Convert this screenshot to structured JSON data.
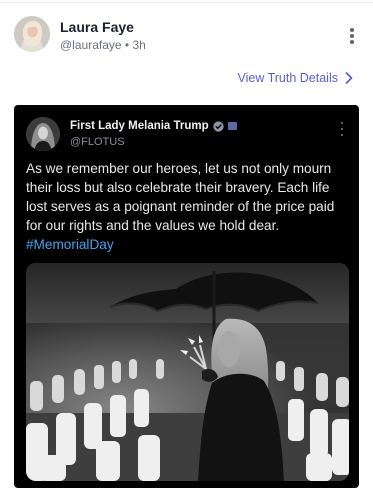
{
  "post": {
    "author_name": "Laura Faye",
    "author_handle": "@laurafaye",
    "separator": "•",
    "time_ago": "3h",
    "details_link": "View Truth Details"
  },
  "embedded": {
    "author_name": "First Lady Melania Trump",
    "author_handle": "@FLOTUS",
    "body": "As we remember our heroes, let us not only mourn their loss but also celebrate their bravery. Each life lost serves as a poignant reminder of the price paid for our rights and the values we hold dear.",
    "hashtag": "#MemorialDay"
  },
  "colors": {
    "link": "#5b5fd6",
    "hashtag": "#3ea6f2",
    "verified_badge": "#8d95a3",
    "card_background": "#000000"
  },
  "icons": {
    "more_options": "vertical-ellipsis",
    "details_chevron": "chevron-right",
    "verified": "verified-badge",
    "affiliate": "government-flag"
  }
}
